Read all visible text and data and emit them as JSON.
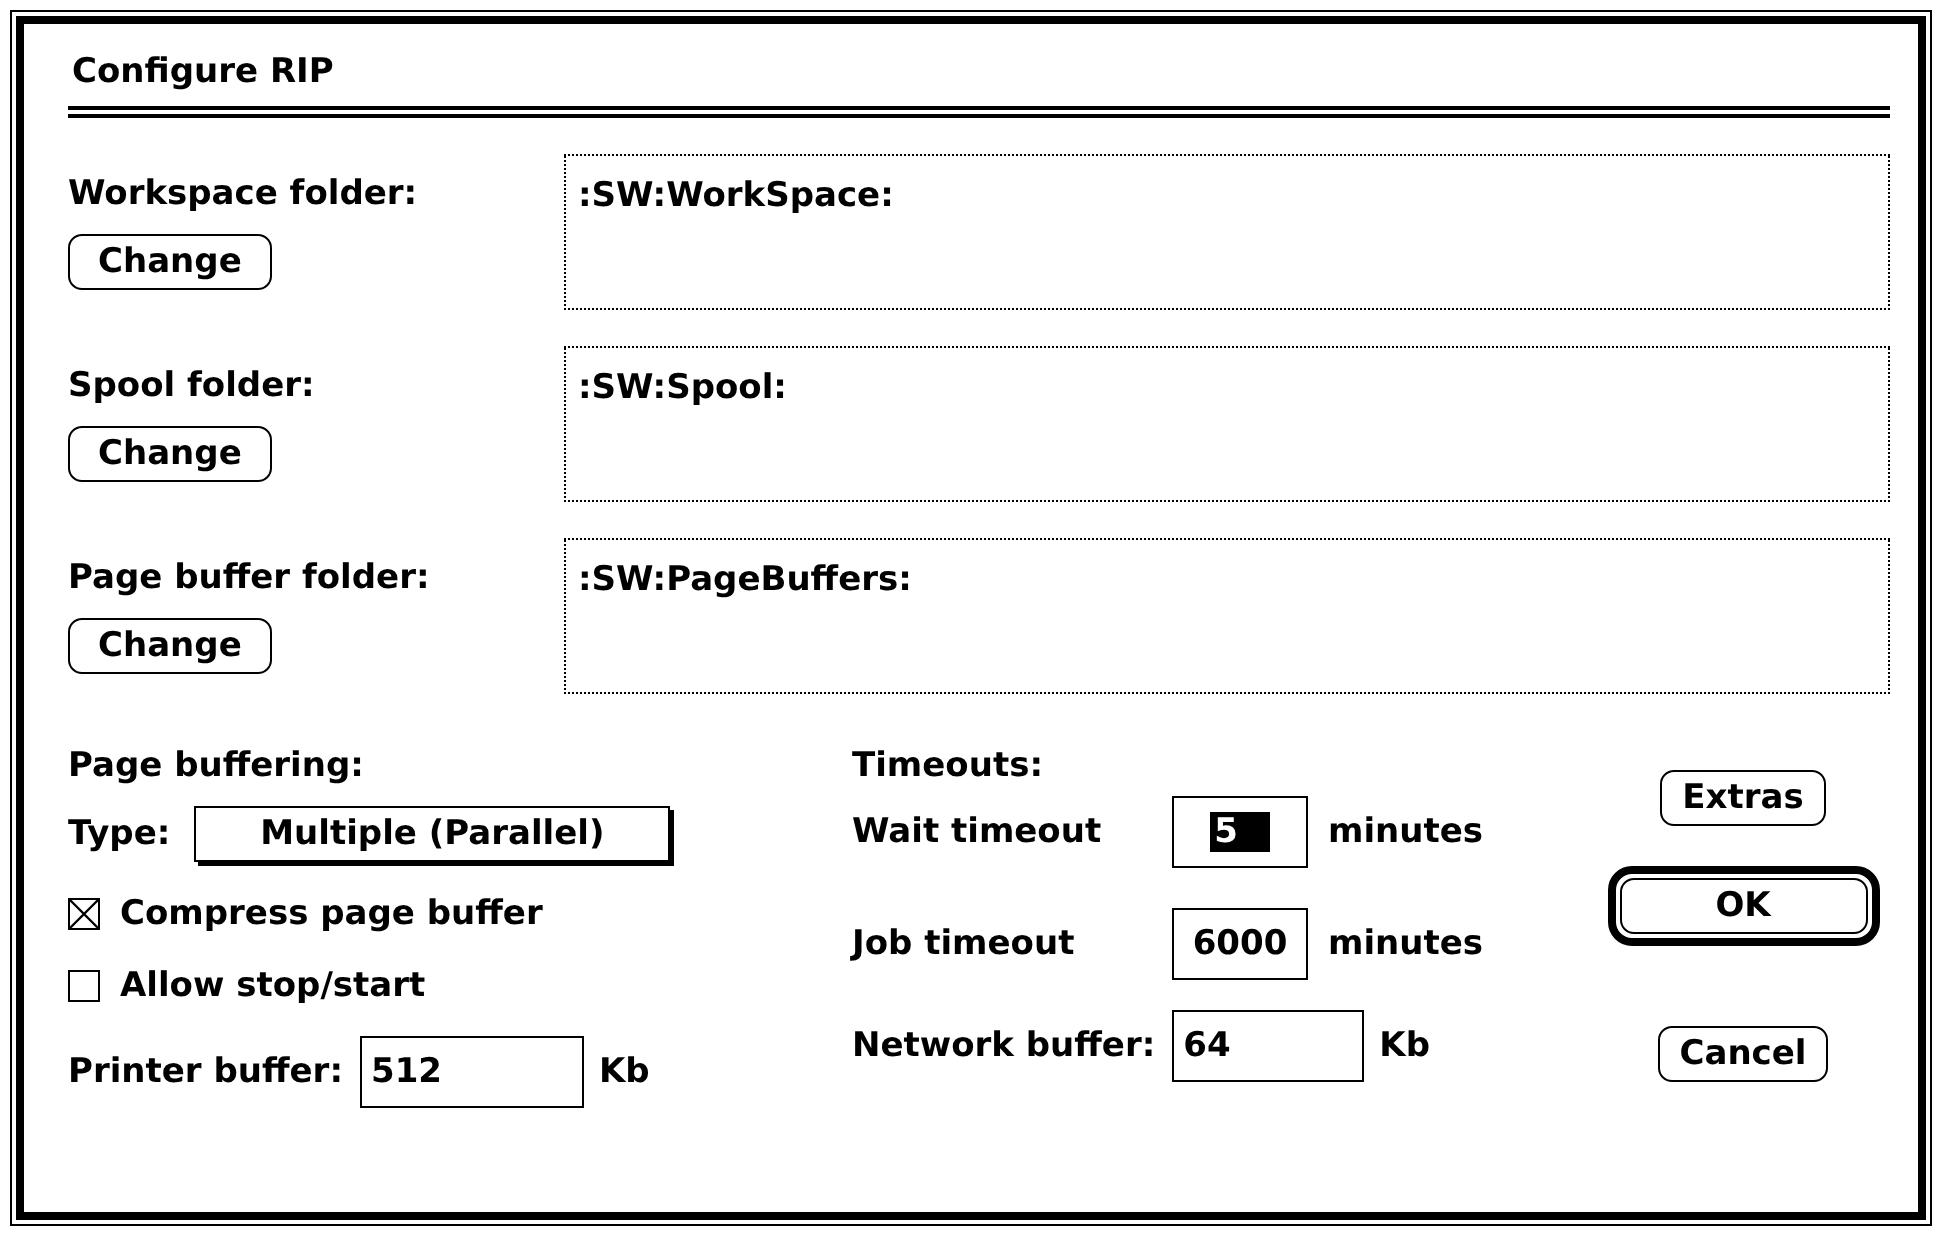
{
  "dialog": {
    "title": "Configure RIP"
  },
  "folders": [
    {
      "label": "Workspace folder:",
      "path": ":SW:WorkSpace:",
      "button": "Change"
    },
    {
      "label": "Spool folder:",
      "path": ":SW:Spool:",
      "button": "Change"
    },
    {
      "label": "Page buffer folder:",
      "path": ":SW:PageBuffers:",
      "button": "Change"
    }
  ],
  "page_buffering": {
    "heading": "Page buffering:",
    "type_label": "Type:",
    "type_value": "Multiple (Parallel)",
    "options": [
      {
        "label": "Compress page buffer",
        "checked": true
      },
      {
        "label": "Allow stop/start",
        "checked": false
      }
    ],
    "printer_buffer": {
      "label": "Printer buffer:",
      "value": "512",
      "unit": "Kb"
    }
  },
  "timeouts": {
    "heading": "Timeouts:",
    "fields": [
      {
        "label": "Wait timeout",
        "value": "5",
        "unit": "minutes",
        "text_selected": true
      },
      {
        "label": "Job timeout",
        "value": "6000",
        "unit": "minutes",
        "text_selected": false
      }
    ]
  },
  "network_buffer": {
    "label": "Network buffer:",
    "value": "64",
    "unit": "Kb"
  },
  "buttons": [
    {
      "label": "Extras",
      "default": false
    },
    {
      "label": "OK",
      "default": true
    },
    {
      "label": "Cancel",
      "default": false
    }
  ]
}
